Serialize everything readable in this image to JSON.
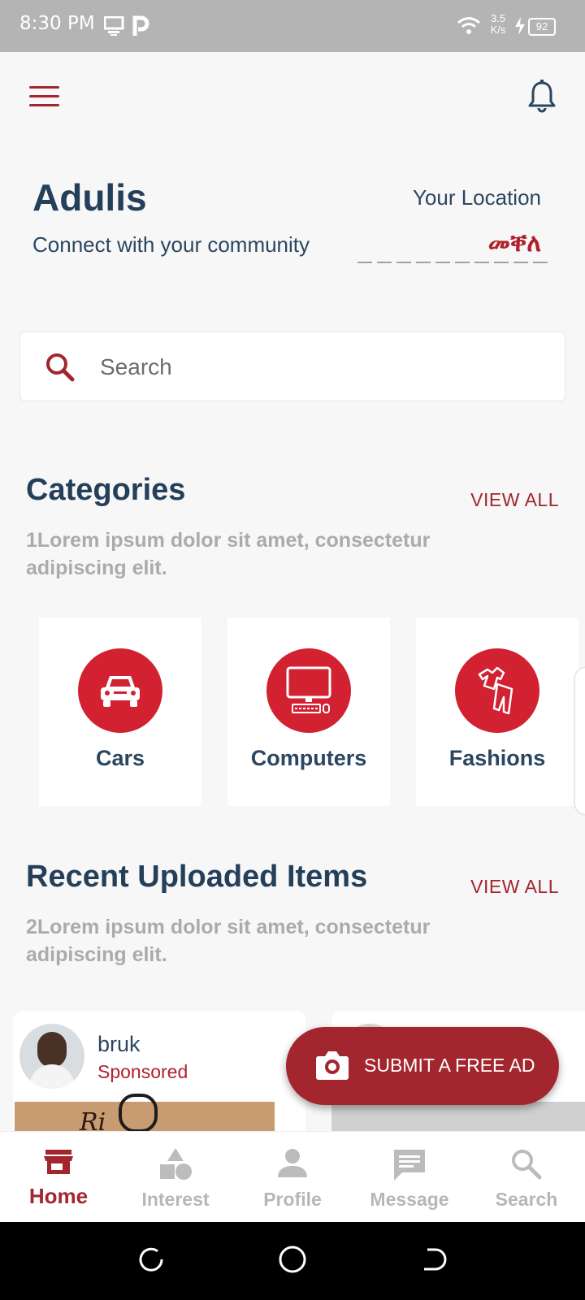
{
  "status_bar": {
    "time": "8:30 PM",
    "network_speed": "3.5\nK/s",
    "battery": "92"
  },
  "header": {
    "title": "Adulis",
    "subtitle": "Connect with your community",
    "location_label": "Your Location",
    "location_value": "መቐለ"
  },
  "search": {
    "placeholder": "Search"
  },
  "categories": {
    "title": "Categories",
    "view_all": "VIEW ALL",
    "description": "1Lorem ipsum dolor sit amet, consectetur adipiscing elit.",
    "items": [
      {
        "label": "Cars",
        "icon": "car-icon"
      },
      {
        "label": "Computers",
        "icon": "computer-icon"
      },
      {
        "label": "Fashions",
        "icon": "clothes-icon"
      }
    ]
  },
  "recent": {
    "title": "Recent Uploaded Items",
    "view_all": "VIEW ALL",
    "description": "2Lorem ipsum dolor sit amet, consectetur adipiscing elit.",
    "items": [
      {
        "user": "bruk",
        "tag": "Sponsored"
      }
    ]
  },
  "fab": {
    "label": "SUBMIT A FREE AD"
  },
  "bottom_nav": {
    "items": [
      {
        "label": "Home",
        "icon": "store-icon",
        "active": true
      },
      {
        "label": "Interest",
        "icon": "shapes-icon"
      },
      {
        "label": "Profile",
        "icon": "person-icon"
      },
      {
        "label": "Message",
        "icon": "chat-icon"
      },
      {
        "label": "Search",
        "icon": "search-icon"
      }
    ]
  },
  "colors": {
    "accent": "#a3262f",
    "category_circle": "#d22232",
    "heading": "#243f5a",
    "background": "#f7f7f7"
  }
}
